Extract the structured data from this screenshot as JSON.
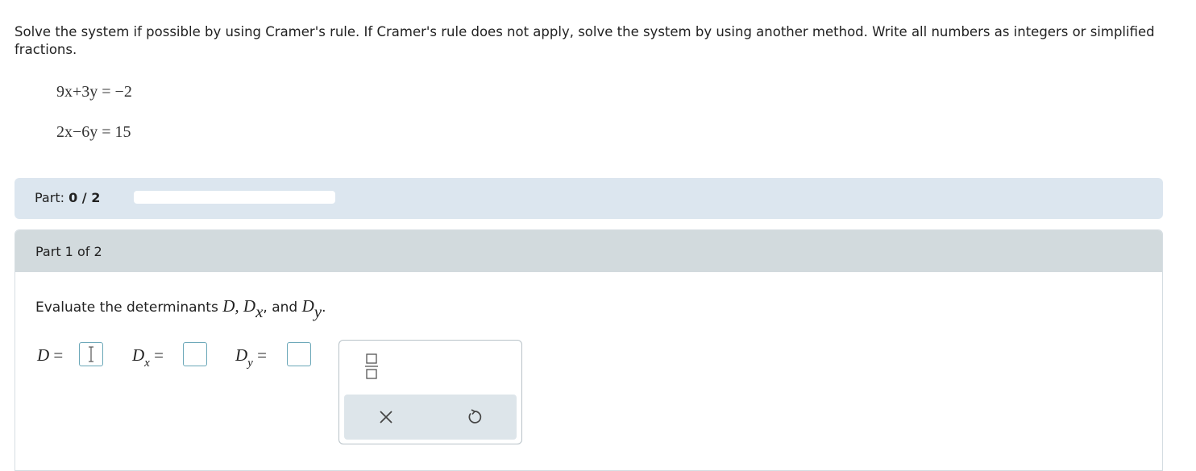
{
  "instructions": "Solve the system if possible by using Cramer's rule. If Cramer's rule does not apply, solve the system by using another method. Write all numbers as integers or simplified fractions.",
  "equations": [
    "9x+3y = −2",
    "2x−6y = 15"
  ],
  "progress": {
    "label": "Part:",
    "value": "0 / 2",
    "fraction": 0
  },
  "part": {
    "title": "Part 1 of 2",
    "prompt_text": "Evaluate the determinants",
    "prompt_and": "and"
  },
  "answers": {
    "d_label": "D",
    "dx_label": "D",
    "dx_sub": "x",
    "dy_label": "D",
    "dy_sub": "y",
    "equals": "="
  },
  "toolbar": {
    "icons": [
      "fraction-icon",
      "close-icon",
      "undo-icon"
    ]
  },
  "colors": {
    "progress_bg": "#dce6ef",
    "part_header_bg": "#d2dadd",
    "input_border": "#6aa7b8"
  }
}
